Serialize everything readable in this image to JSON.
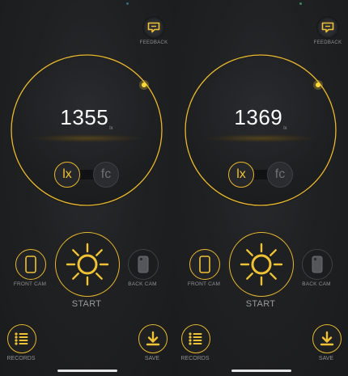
{
  "colors": {
    "accent": "#e8b72c",
    "background": "#1b1c1e",
    "value_text": "#ffffff"
  },
  "screens": [
    {
      "feedback_label": "FEEDBACK",
      "reading_value": "1355",
      "reading_unit": "lx",
      "unit_lx_label": "lx",
      "unit_fc_label": "fc",
      "selected_unit": "lx",
      "front_cam_label": "FRONT CAM",
      "back_cam_label": "BACK CAM",
      "start_label": "START",
      "records_label": "RECORDS",
      "save_label": "SAVE"
    },
    {
      "feedback_label": "FEEDBACK",
      "reading_value": "1369",
      "reading_unit": "lx",
      "unit_lx_label": "lx",
      "unit_fc_label": "fc",
      "selected_unit": "lx",
      "front_cam_label": "FRONT CAM",
      "back_cam_label": "BACK CAM",
      "start_label": "START",
      "records_label": "RECORDS",
      "save_label": "SAVE"
    }
  ],
  "icons": {
    "feedback": "speech-bubble-icon",
    "front_cam": "phone-front-icon",
    "back_cam": "phone-back-icon",
    "start": "sun-icon",
    "records": "list-icon",
    "save": "download-arrow-icon"
  }
}
